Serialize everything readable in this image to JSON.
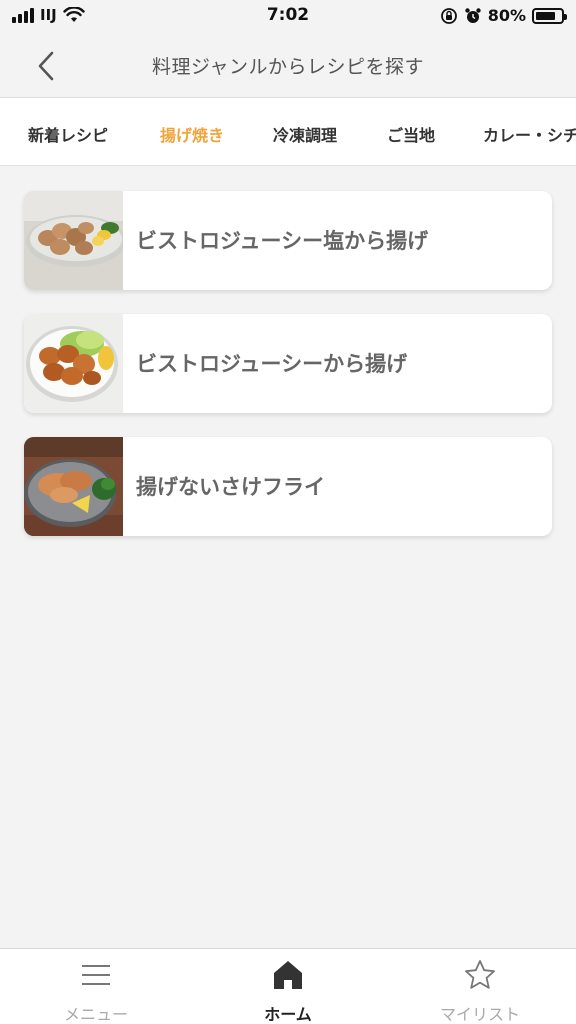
{
  "status_bar": {
    "carrier": "IIJ",
    "time": "7:02",
    "battery_percent_text": "80%",
    "battery_level": 0.8,
    "icons": [
      "signal-icon",
      "wifi-icon",
      "orientation-lock-icon",
      "alarm-icon",
      "battery-icon"
    ]
  },
  "header": {
    "back_icon": "chevron-left-icon",
    "title": "料理ジャンルからレシピを探す"
  },
  "tabs": [
    {
      "label": "新着レシピ",
      "active": false
    },
    {
      "label": "揚げ焼き",
      "active": true
    },
    {
      "label": "冷凍調理",
      "active": false
    },
    {
      "label": "ご当地",
      "active": false
    },
    {
      "label": "カレー・シチュー",
      "active": false
    }
  ],
  "recipes": [
    {
      "title": "ビストロジューシー塩から揚げ",
      "image": "salt-karaage-photo"
    },
    {
      "title": "ビストロジューシーから揚げ",
      "image": "karaage-photo"
    },
    {
      "title": "揚げないさけフライ",
      "image": "salmon-fry-photo"
    }
  ],
  "bottom_nav": [
    {
      "label": "メニュー",
      "icon": "menu-icon",
      "active": false
    },
    {
      "label": "ホーム",
      "icon": "home-icon",
      "active": true
    },
    {
      "label": "マイリスト",
      "icon": "star-icon",
      "active": false
    }
  ],
  "colors": {
    "accent": "#f0a43a",
    "background": "#f3f3f3",
    "card": "#ffffff",
    "text_muted": "#666666"
  }
}
